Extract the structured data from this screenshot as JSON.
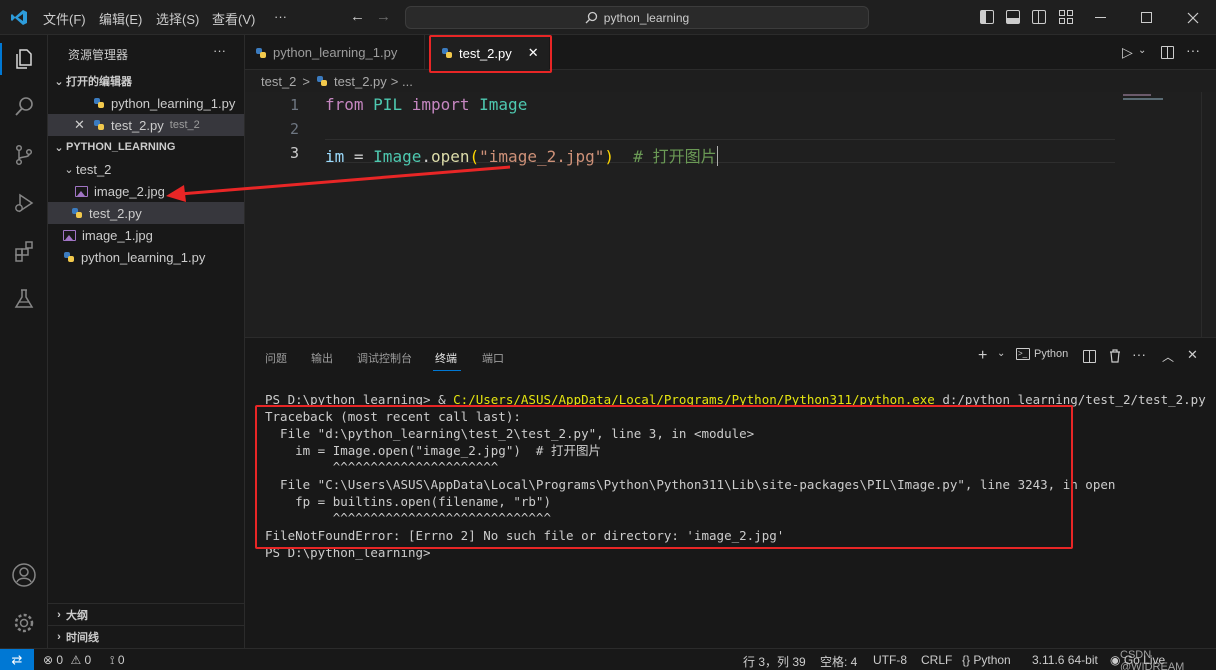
{
  "menu": [
    "文件(F)",
    "编辑(E)",
    "选择(S)",
    "查看(V)",
    "···"
  ],
  "search": {
    "text": "python_learning"
  },
  "sidebar": {
    "title": "资源管理器",
    "more": "···",
    "open_editors_label": "打开的编辑器",
    "open_editors": [
      {
        "name": "python_learning_1.py"
      },
      {
        "name": "test_2.py",
        "hint": "test_2"
      }
    ],
    "folder_label": "PYTHON_LEARNING",
    "tree": {
      "subfolder": "test_2",
      "subfolder_files": [
        "image_2.jpg",
        "test_2.py"
      ],
      "root_files": [
        "image_1.jpg",
        "python_learning_1.py"
      ]
    },
    "outline_label": "大纲",
    "timeline_label": "时间线"
  },
  "tabs": [
    {
      "label": "python_learning_1.py",
      "active": false
    },
    {
      "label": "test_2.py",
      "active": true
    }
  ],
  "breadcrumb": {
    "folder": "test_2",
    "sep": ">",
    "file": "test_2.py",
    "tail": "> ..."
  },
  "editor": {
    "line_numbers": [
      "1",
      "2",
      "3"
    ],
    "line1": {
      "kw1": "from",
      "mod": "PIL",
      "kw2": "import",
      "cls": "Image"
    },
    "line3": {
      "var": "im",
      "eq": " = ",
      "cls": "Image",
      "dot": ".",
      "fn": "open",
      "lp": "(",
      "str": "\"image_2.jpg\"",
      "rp": ")",
      "cmt": "  # 打开图片"
    }
  },
  "panel": {
    "tabs": [
      "问题",
      "输出",
      "调试控制台",
      "终端",
      "端口"
    ],
    "active_tab": "终端",
    "shell_label": "Python"
  },
  "terminal": {
    "prompt_prefix": "PS D:\\python_learning> & ",
    "prompt_exe": "C:/Users/ASUS/AppData/Local/Programs/Python/Python311/python.exe",
    "prompt_arg": " d:/python_learning/test_2/test_2.py",
    "lines": [
      "Traceback (most recent call last):",
      "  File \"d:\\python_learning\\test_2\\test_2.py\", line 3, in <module>",
      "    im = Image.open(\"image_2.jpg\")  # 打开图片",
      "         ^^^^^^^^^^^^^^^^^^^^^^",
      "  File \"C:\\Users\\ASUS\\AppData\\Local\\Programs\\Python\\Python311\\Lib\\site-packages\\PIL\\Image.py\", line 3243, in open",
      "    fp = builtins.open(filename, \"rb\")",
      "         ^^^^^^^^^^^^^^^^^^^^^^^^^^^^^",
      "FileNotFoundError: [Errno 2] No such file or directory: 'image_2.jpg'",
      "PS D:\\python_learning> "
    ]
  },
  "status": {
    "errors": "0",
    "warnings": "0",
    "ports": "0",
    "position": "行 3，列 39",
    "spaces": "空格: 4",
    "encoding": "UTF-8",
    "eol": "CRLF",
    "language": "Python",
    "interpreter": "3.11.6 64-bit",
    "golive": "Go Live",
    "watermark": "CSDN @WIDREAM"
  },
  "colors": {
    "accent": "#0078d4",
    "annotation": "#e82626"
  }
}
